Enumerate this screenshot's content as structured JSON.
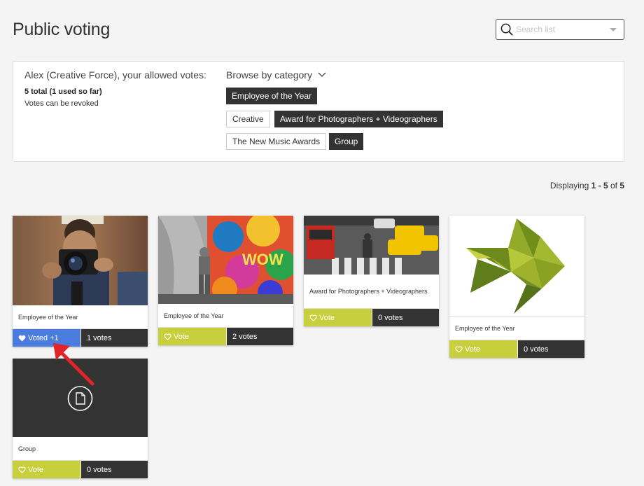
{
  "page": {
    "title": "Public voting"
  },
  "search": {
    "placeholder": "Search list"
  },
  "panel": {
    "allowed_title": "Alex (Creative Force), your allowed votes:",
    "total": "5 total (1 used so far)",
    "note": "Votes can be revoked",
    "browse_label": "Browse by category",
    "categories": [
      {
        "label": "Employee of the Year",
        "style": "dark"
      },
      {
        "label": "Creative",
        "style": "light"
      },
      {
        "label": "Award for Photographers + Videographers",
        "style": "dark"
      },
      {
        "label": "The New Music Awards",
        "style": "light"
      },
      {
        "label": "Group",
        "style": "dark"
      }
    ]
  },
  "displaying": {
    "prefix": "Displaying ",
    "range": "1 - 5",
    "of": " of ",
    "total": "5"
  },
  "cards": [
    {
      "caption": "Employee of the Year",
      "vote_label": "Voted +1",
      "votes": "1 votes",
      "voted": true,
      "image": "photographer-with-camera"
    },
    {
      "caption": "Employee of the Year",
      "vote_label": "Vote",
      "votes": "2 votes",
      "voted": false,
      "image": "graffiti-wall-child"
    },
    {
      "caption": "Award for Photographers + Videographers",
      "vote_label": "Vote",
      "votes": "0 votes",
      "voted": false,
      "image": "taxi-street"
    },
    {
      "caption": "Employee of the Year",
      "vote_label": "Vote",
      "votes": "0 votes",
      "voted": false,
      "image": "polygon-fish"
    },
    {
      "caption": "Group",
      "vote_label": "Vote",
      "votes": "0 votes",
      "voted": false,
      "image": "document-icon"
    }
  ],
  "colors": {
    "vote": "#c8cf3c",
    "voted": "#4a7bdf",
    "dark": "#333333",
    "arrow": "#e0242a"
  }
}
